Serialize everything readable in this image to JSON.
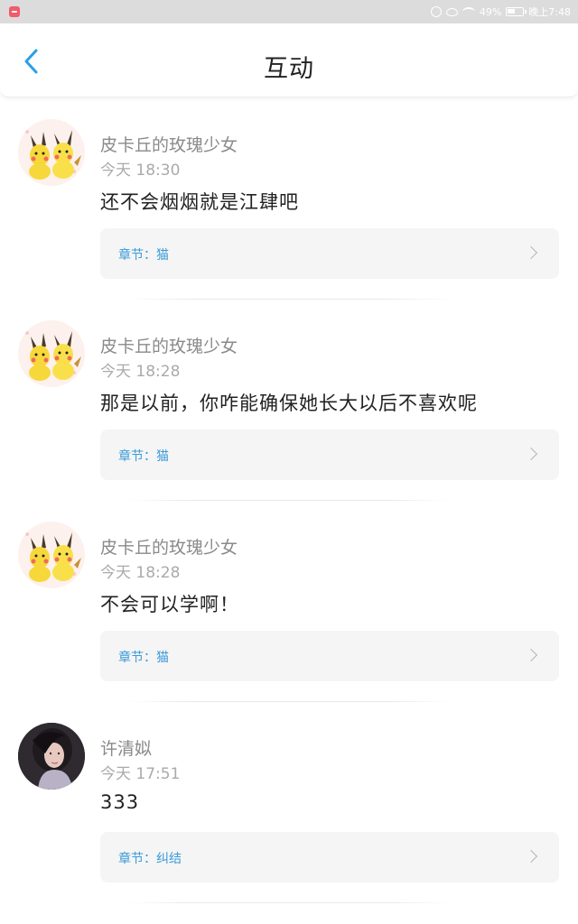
{
  "status_bar": {
    "battery": "49%",
    "time": "晚上7:48"
  },
  "header": {
    "title": "互动"
  },
  "comments": [
    {
      "username": "皮卡丘的玫瑰少女",
      "time": "今天 18:30",
      "text": "还不会烟烟就是江肆吧",
      "chapter": "章节：猫",
      "avatar": "pikachu-avatar"
    },
    {
      "username": "皮卡丘的玫瑰少女",
      "time": "今天 18:28",
      "text": "那是以前，你咋能确保她长大以后不喜欢呢",
      "chapter": "章节：猫",
      "avatar": "pikachu-avatar"
    },
    {
      "username": "皮卡丘的玫瑰少女",
      "time": "今天 18:28",
      "text": "不会可以学啊！",
      "chapter": "章节：猫",
      "avatar": "pikachu-avatar"
    },
    {
      "username": "许清姒",
      "time": "今天 17:51",
      "text": "333",
      "chapter": "章节：纠结",
      "avatar": "photo-avatar"
    }
  ],
  "colors": {
    "accent": "#2b9fe6",
    "chapter_text": "#3a9ad9",
    "status_bar": "#dcdcdc"
  }
}
